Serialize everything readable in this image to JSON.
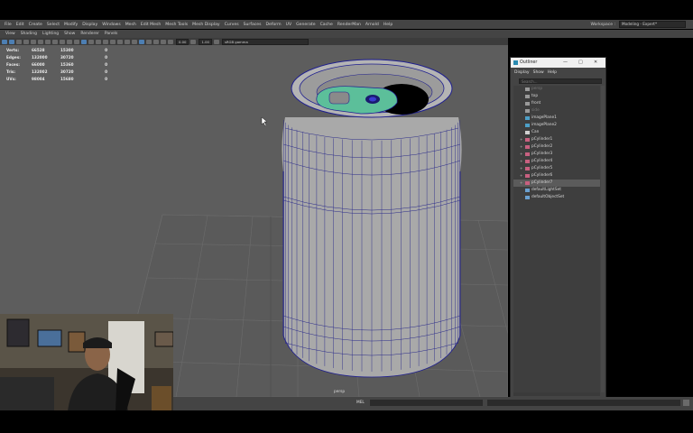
{
  "menubar": {
    "items": [
      "File",
      "Edit",
      "Create",
      "Select",
      "Modify",
      "Display",
      "Windows",
      "Mesh",
      "Edit Mesh",
      "Mesh Tools",
      "Mesh Display",
      "Curves",
      "Surfaces",
      "Deform",
      "UV",
      "Generate",
      "Cache",
      "RenderMan",
      "Arnold",
      "Help"
    ],
    "workspace_label": "Workspace :",
    "workspace_value": "Modeling - Expert*"
  },
  "panel_menu": {
    "items": [
      "View",
      "Shading",
      "Lighting",
      "Show",
      "Renderer",
      "Panels"
    ]
  },
  "toolbar": {
    "field1": "0.00",
    "field2": "1.00",
    "camera_select": "sRGB gamma"
  },
  "hud": {
    "rows": [
      {
        "label": "Verts:",
        "a": "66528",
        "b": "15300",
        "c": "0"
      },
      {
        "label": "Edges:",
        "a": "132000",
        "b": "30720",
        "c": "0"
      },
      {
        "label": "Faces:",
        "a": "66000",
        "b": "15360",
        "c": "0"
      },
      {
        "label": "Tris:",
        "a": "132002",
        "b": "30720",
        "c": "0"
      },
      {
        "label": "UVs:",
        "a": "98004",
        "b": "15680",
        "c": "0"
      }
    ]
  },
  "viewport": {
    "camera_label": "persp"
  },
  "command_line": {
    "label": "MEL"
  },
  "outliner": {
    "title": "Outliner",
    "menu": [
      "Display",
      "Show",
      "Help"
    ],
    "search_placeholder": "Search...",
    "items": [
      {
        "label": "persp",
        "dim": true
      },
      {
        "label": "top",
        "dim": false
      },
      {
        "label": "front",
        "dim": false
      },
      {
        "label": "side",
        "dim": true
      },
      {
        "label": "imagePlane1",
        "dim": false
      },
      {
        "label": "imagePlane2",
        "dim": false
      },
      {
        "label": "Can",
        "dim": false
      },
      {
        "label": "pCylinder1",
        "dim": false
      },
      {
        "label": "pCylinder2",
        "dim": false
      },
      {
        "label": "pCylinder3",
        "dim": false
      },
      {
        "label": "pCylinder4",
        "dim": false
      },
      {
        "label": "pCylinder5",
        "dim": false
      },
      {
        "label": "pCylinder6",
        "dim": false
      },
      {
        "label": "pCylinder7",
        "dim": false,
        "selected": true
      },
      {
        "label": "defaultLightSet",
        "dim": false
      },
      {
        "label": "defaultObjectSet",
        "dim": false
      }
    ]
  },
  "colors": {
    "wire": "#1f1f8f",
    "lid_green": "#5cbf9a",
    "viewport_bg": "#5d5d5d",
    "selection": "#4d7fb3"
  }
}
